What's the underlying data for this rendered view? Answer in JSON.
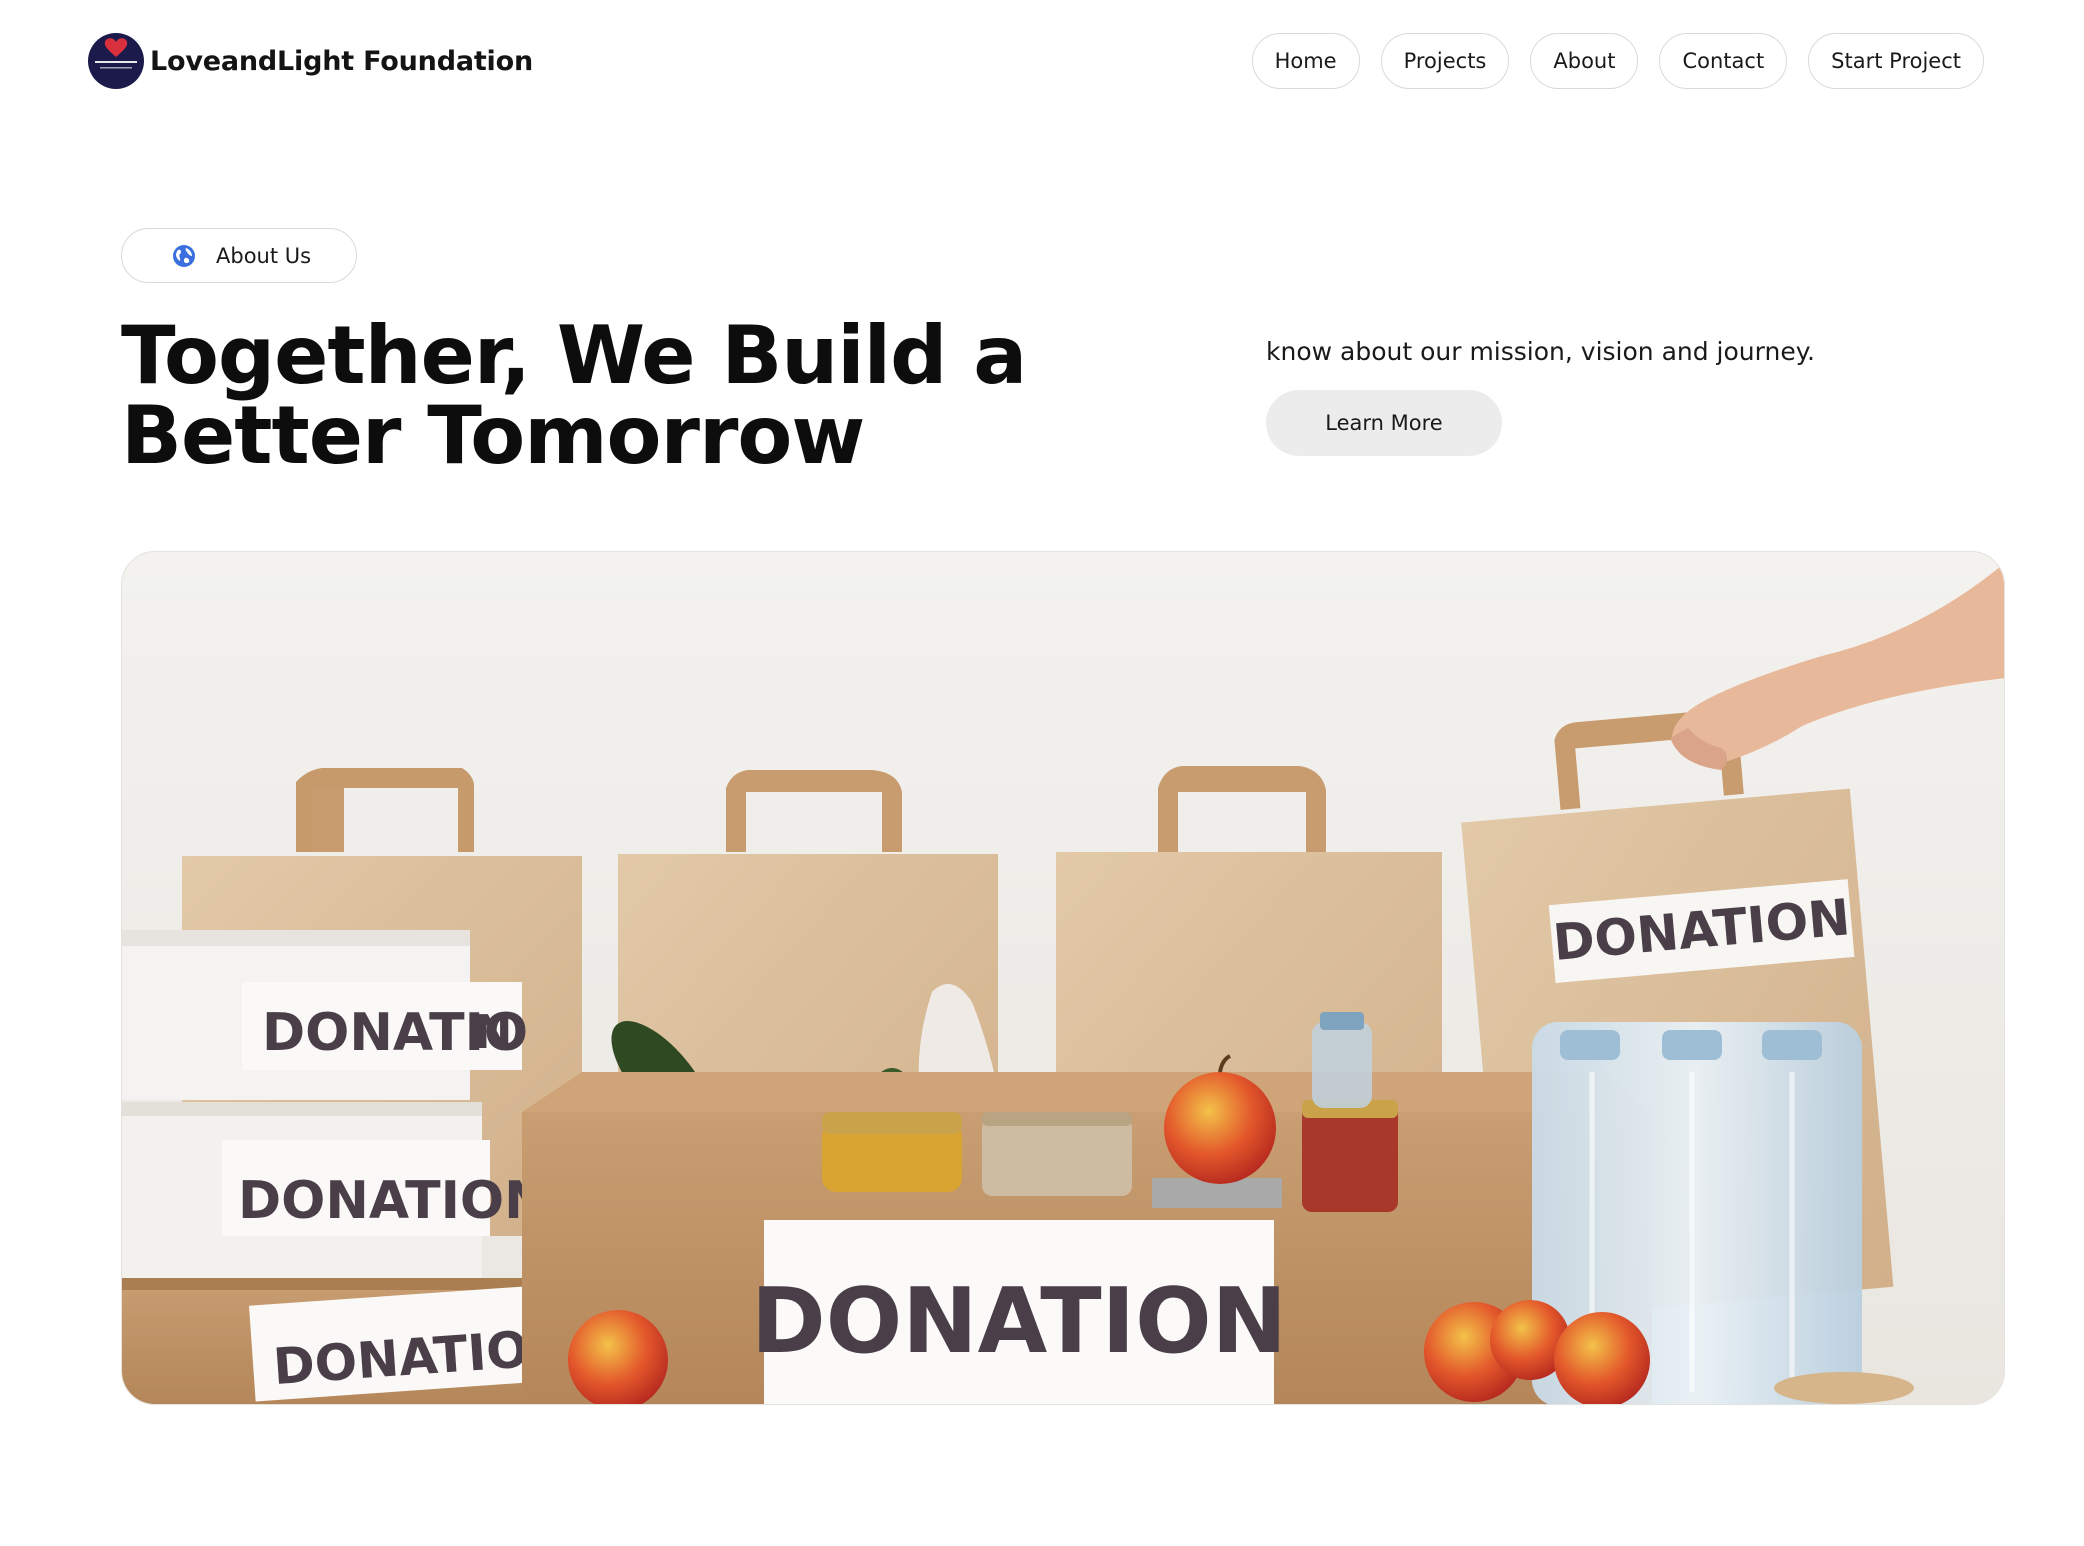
{
  "brand": {
    "name": "LoveandLight Foundation",
    "logo_icon": "heart-logo-icon",
    "logo_bg": "#1c1a4a",
    "logo_heart_color": "#d9303e",
    "logo_text": "Love and Light"
  },
  "nav": {
    "items": [
      {
        "label": "Home"
      },
      {
        "label": "Projects"
      },
      {
        "label": "About"
      },
      {
        "label": "Contact"
      },
      {
        "label": "Start Project"
      }
    ]
  },
  "hero": {
    "badge": {
      "icon": "globe-icon",
      "label": "About Us",
      "icon_color": "#3b6fe0"
    },
    "title": "Together, We Build a Better Tomorrow",
    "subtitle": "know about our mission, vision and journey.",
    "cta_label": "Learn More"
  },
  "photo": {
    "labels": {
      "box_top": "DONATIO",
      "box_top_sticker": "N",
      "box_middle": "DONATION",
      "box_bottom": "DONATION",
      "crate": "DONATION",
      "bag_right": "DONATION"
    }
  }
}
